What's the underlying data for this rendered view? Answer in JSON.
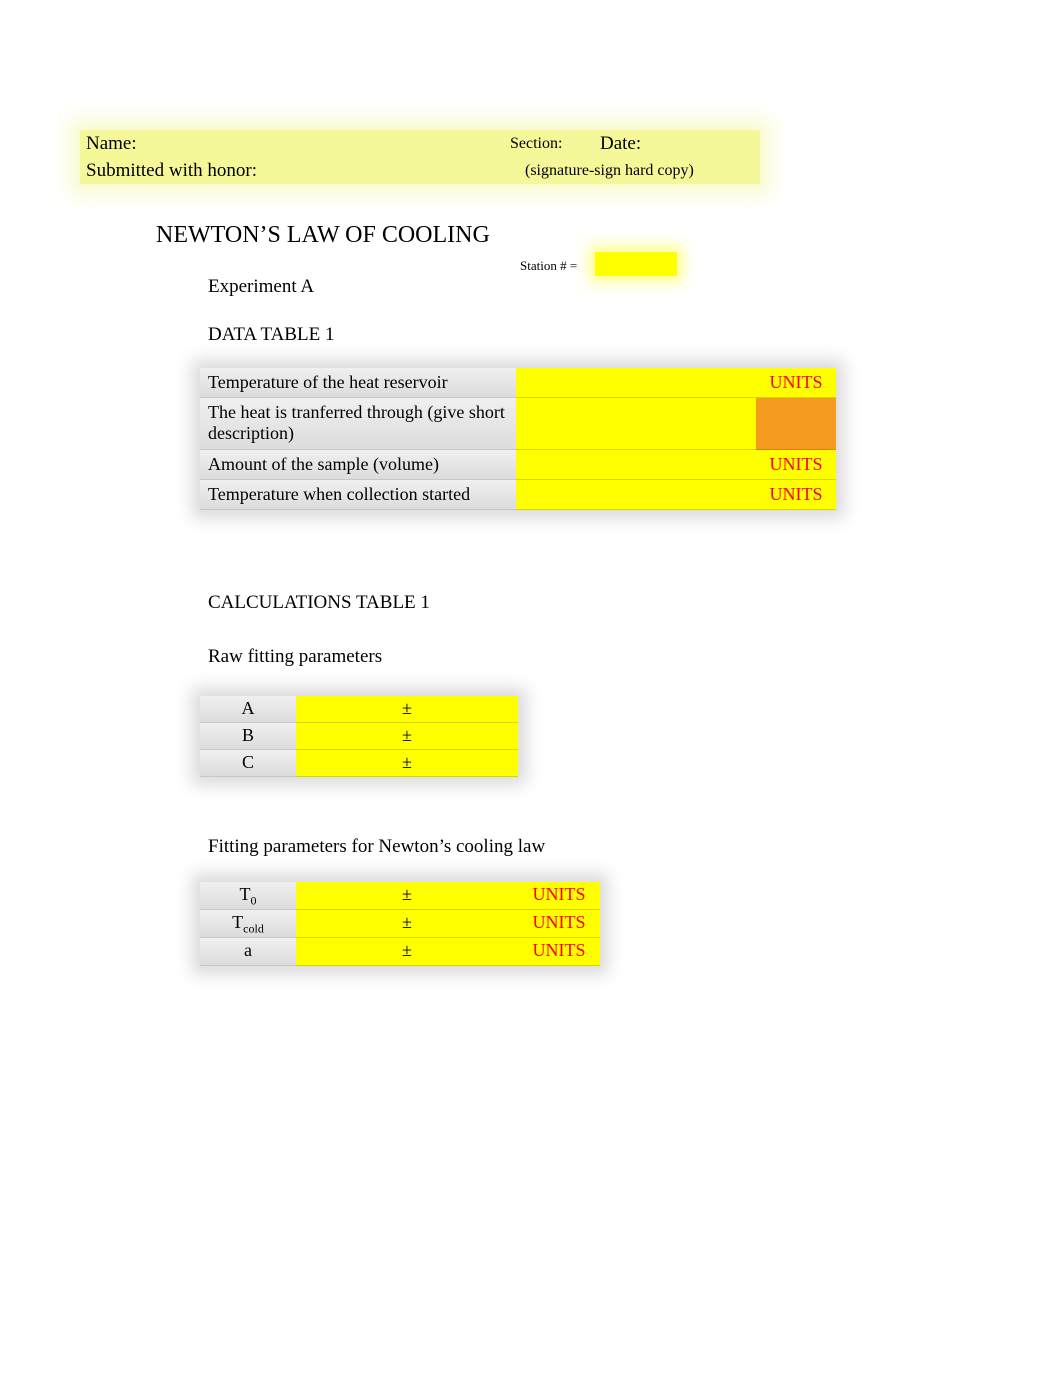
{
  "header": {
    "name_label": "Name:",
    "section_label": "Section:",
    "date_label": "Date:",
    "honor_label": "Submitted with honor:",
    "signature_note": "(signature-sign hard copy)"
  },
  "title": "NEWTON’S LAW OF COOLING",
  "station_label": "Station # =",
  "experiment_label": "Experiment A",
  "data_table1": {
    "heading": "DATA TABLE 1",
    "rows": [
      {
        "label": "Temperature of the heat reservoir",
        "units": "UNITS",
        "units_bg": "yellow"
      },
      {
        "label": "The heat is tranferred through (give short description)",
        "units": "",
        "units_bg": "orange"
      },
      {
        "label": "Amount of the sample (volume)",
        "units": "UNITS",
        "units_bg": "yellow"
      },
      {
        "label": "Temperature when collection started",
        "units": "UNITS",
        "units_bg": "yellow"
      }
    ]
  },
  "calc_heading": "CALCULATIONS TABLE 1",
  "raw_heading": "Raw fitting parameters",
  "raw_params": [
    {
      "sym": "A",
      "pm": "±"
    },
    {
      "sym": "B",
      "pm": "±"
    },
    {
      "sym": "C",
      "pm": "±"
    }
  ],
  "fit_heading": "Fitting parameters for Newton’s cooling law",
  "fit_params": [
    {
      "sym_base": "T",
      "sym_sub": "0",
      "pm": "±",
      "units": "UNITS"
    },
    {
      "sym_base": "T",
      "sym_sub": "cold",
      "pm": "±",
      "units": "UNITS"
    },
    {
      "sym_base": "a",
      "sym_sub": "",
      "pm": "±",
      "units": "UNITS"
    }
  ]
}
